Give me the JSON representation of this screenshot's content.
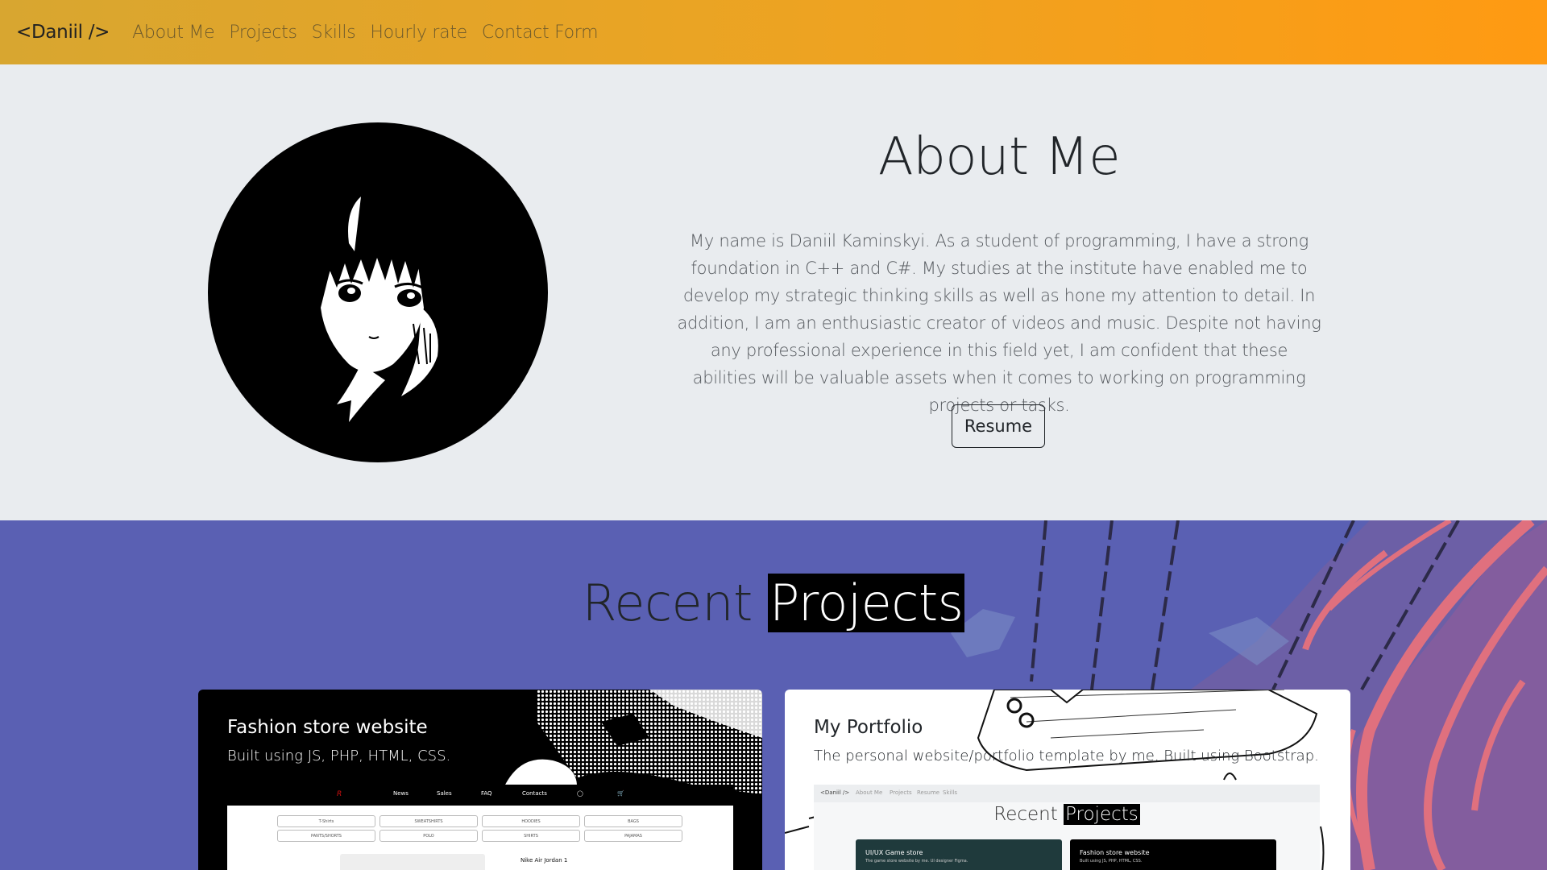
{
  "nav": {
    "brand": "<Daniil />",
    "links": [
      "About Me",
      "Projects",
      "Skills",
      "Hourly rate",
      "Contact Form"
    ]
  },
  "about": {
    "title": "About Me",
    "text": "My name is Daniil Kaminskyi. As a student of programming, I have a strong foundation in C++ and C#. My studies at the institute have enabled me to develop my strategic thinking skills as well as hone my attention to detail. In addition, I am an enthusiastic creator of videos and music. Despite not having any professional experience in this field yet, I am confident that these abilities will be valuable assets when it comes to working on programming projects or tasks.",
    "resume_label": "Resume"
  },
  "projects": {
    "title_part1": "Recent",
    "title_part2": "Projects",
    "cards": [
      {
        "title": "Fashion store website",
        "description": "Built using JS, PHP, HTML, CSS.",
        "preview": {
          "nav": [
            "News",
            "Sales",
            "FAQ",
            "Contacts"
          ],
          "chips": [
            "T-Shirts",
            "SWEATSHIRTS",
            "HOODIES",
            "BAGS",
            "PANTS/SHORTS",
            "POLO",
            "SHIRTS",
            "PAJAMAS"
          ],
          "product": "Nike Air Jordan 1"
        }
      },
      {
        "title": "My Portfolio",
        "description": "The personal website/portfolio template by me. Built using Bootstrap.",
        "preview": {
          "brand": "<Daniil />",
          "nav": [
            "About Me",
            "Projects",
            "Resume",
            "Skills"
          ],
          "title_part1": "Recent",
          "title_part2": "Projects",
          "thumb1_title": "UI/UX Game store",
          "thumb1_desc": "The game store website by me. UI designer Figma.",
          "thumb2_title": "Fashion store website",
          "thumb2_desc": "Built using JS, PHP, HTML, CSS."
        }
      }
    ]
  },
  "colors": {
    "nav_gradient_start": "#d8a630",
    "nav_gradient_end": "#ff9a12",
    "about_bg": "#e9ecef",
    "projects_bg": "#5a60b3",
    "accent_pink": "#e0707e"
  }
}
